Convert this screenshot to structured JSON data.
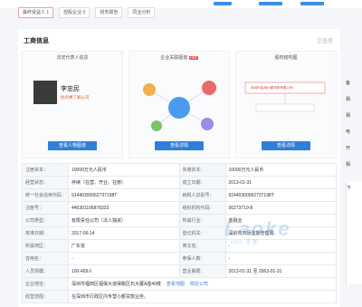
{
  "tabs": [
    "最终受益人 1",
    "控股企业 0",
    "财务报告",
    "同业分析"
  ],
  "section": {
    "title": "工商信息",
    "logo": "企查查"
  },
  "cards": {
    "legal": {
      "title": "法定代表人信息",
      "name": "李忠民",
      "sub": "他有棵了解公司",
      "button": "查看人物图谱"
    },
    "map": {
      "title": "企业关联图谱",
      "badge": "HOT",
      "button": "查看详情"
    },
    "structure": {
      "title": "股权结构图",
      "company": "深圳市金润小额贷款有限公司",
      "button": "查看详情"
    }
  },
  "table": [
    [
      "注册资本：",
      "10000万元人民币",
      "实缴资本：",
      "10000万元人民币"
    ],
    [
      "经营状态：",
      "存续（在营、开业、在册）",
      "成立日期：",
      "2013-01-31"
    ],
    [
      "统一社会信用代码：",
      "91440300062737198T",
      "纳税人识别号：",
      "91440300062737198T"
    ],
    [
      "注册号：",
      "440301106878333",
      "组织机构代码：",
      "06273719-8"
    ],
    [
      "公司类型：",
      "有限责任公司（法人独资）",
      "所属行业：",
      "金融业"
    ],
    [
      "核准日期：",
      "2017-06-14",
      "登记机关：",
      "深圳市市场监督管理局"
    ],
    [
      "所属地区：",
      "广东省",
      "英文名：",
      "-"
    ],
    [
      "曾用名：",
      "-",
      "参保人数：",
      "-"
    ],
    [
      "人员规模：",
      "100-499人",
      "营业期限：",
      "2013-01-31 至 2063-01-31"
    ],
    [
      "企业地址：",
      "深圳市福田区福保大道保税区石大厦A座40楼",
      "",
      ""
    ],
    [
      "经营范围：",
      "在深圳市行政区内专营小额贷款业务。",
      "",
      ""
    ]
  ],
  "address_links": [
    "查看地图",
    "附近公司"
  ],
  "side": [
    "备",
    "相",
    "相",
    "电",
    "开",
    "相",
    "下"
  ],
  "watermark": {
    "main": "Laoke",
    "sub": ".com 老客"
  },
  "colors": {
    "accent": "#2f7fd8",
    "link": "#3c7cd6"
  }
}
